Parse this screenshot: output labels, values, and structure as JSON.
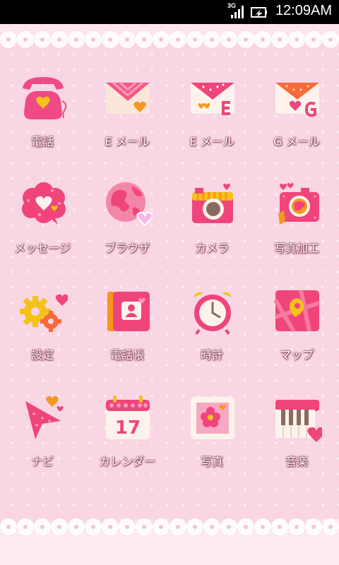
{
  "status_bar": {
    "network": "3G",
    "time": "12:09AM"
  },
  "apps": [
    {
      "label": "電話",
      "icon": "telephone-icon"
    },
    {
      "label": "E メール",
      "icon": "pink-envelope-icon"
    },
    {
      "label": "E メール",
      "icon": "envelope-e-icon"
    },
    {
      "label": "G メール",
      "icon": "envelope-g-icon"
    },
    {
      "label": "メッセージ",
      "icon": "speech-bubble-icon"
    },
    {
      "label": "ブラウザ",
      "icon": "globe-icon"
    },
    {
      "label": "カメラ",
      "icon": "camera-icon"
    },
    {
      "label": "写真加工",
      "icon": "photo-camera-edit-icon"
    },
    {
      "label": "設定",
      "icon": "gears-icon"
    },
    {
      "label": "電話帳",
      "icon": "address-book-icon"
    },
    {
      "label": "時計",
      "icon": "alarm-clock-icon"
    },
    {
      "label": "マップ",
      "icon": "map-icon"
    },
    {
      "label": "ナビ",
      "icon": "navigation-arrow-icon"
    },
    {
      "label": "カレンダー",
      "icon": "calendar-icon"
    },
    {
      "label": "写真",
      "icon": "photo-flower-icon"
    },
    {
      "label": "音楽",
      "icon": "piano-icon"
    }
  ],
  "calendar_day": "17",
  "colors": {
    "background": "#f9d6e4",
    "accent_pink": "#f0457a",
    "accent_orange": "#f7a13a",
    "accent_yellow": "#f5c21a"
  }
}
